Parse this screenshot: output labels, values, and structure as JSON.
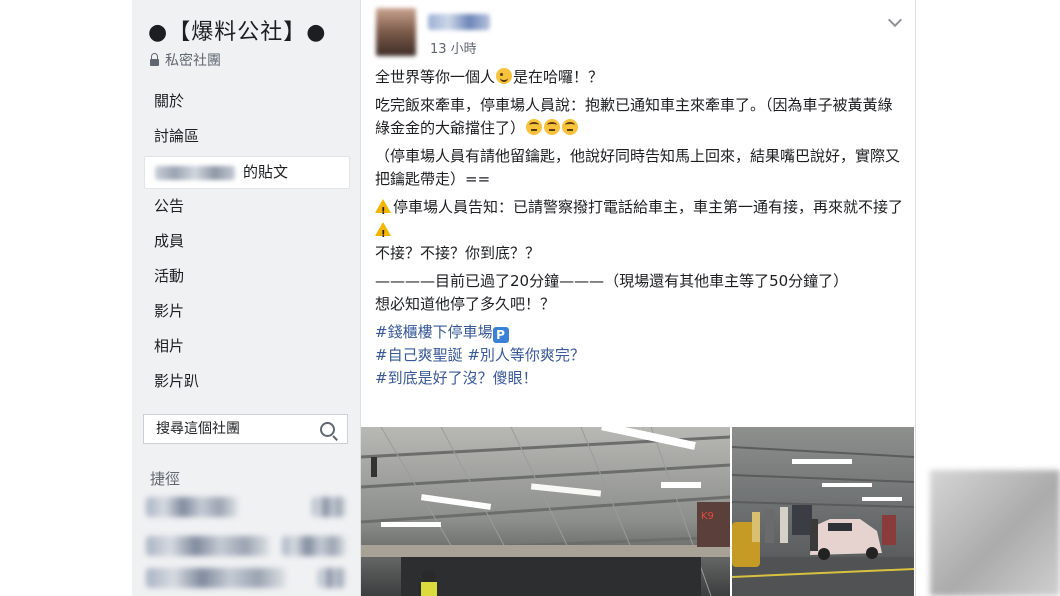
{
  "sidebar": {
    "group_title": "●【爆料公社】●",
    "privacy": "私密社團",
    "nav": [
      {
        "label": "關於"
      },
      {
        "label": "討論區"
      },
      {
        "label": "的貼文"
      },
      {
        "label": "公告"
      },
      {
        "label": "成員"
      },
      {
        "label": "活動"
      },
      {
        "label": "影片"
      },
      {
        "label": "相片"
      },
      {
        "label": "影片趴"
      }
    ],
    "search_placeholder": "搜尋這個社團",
    "shortcuts_title": "捷徑"
  },
  "post": {
    "time": "13 小時",
    "line1_a": "全世界等你一個人",
    "line1_b": "是在哈囉！？",
    "p2": "吃完飯來牽車，停車場人員說：抱歉已通知車主來牽車了。（因為車子被黃黃綠綠金金的大爺擋住了）",
    "p3": "（停車場人員有請他留鑰匙，他說好同時告知馬上回來，結果嘴巴說好，實際又把鑰匙帶走）==",
    "p4": "停車場人員告知：已請警察撥打電話給車主，車主第一通有接，再來就不接了",
    "p5": "不接？不接？你到底？？",
    "p6": "————目前已過了20分鐘———（現場還有其他車主等了50分鐘了）",
    "p7": "想必知道他停了多久吧！？",
    "tag1": "#錢櫃樓下停車場",
    "tag1_icon": "P",
    "tag2": "#自己爽聖誕 #別人等你爽完？",
    "tag3": "#到底是好了沒？傻眼！"
  },
  "colors": {
    "sidebar_bg": "#f0f1f3",
    "link": "#385898",
    "secondary_text": "#606770"
  }
}
